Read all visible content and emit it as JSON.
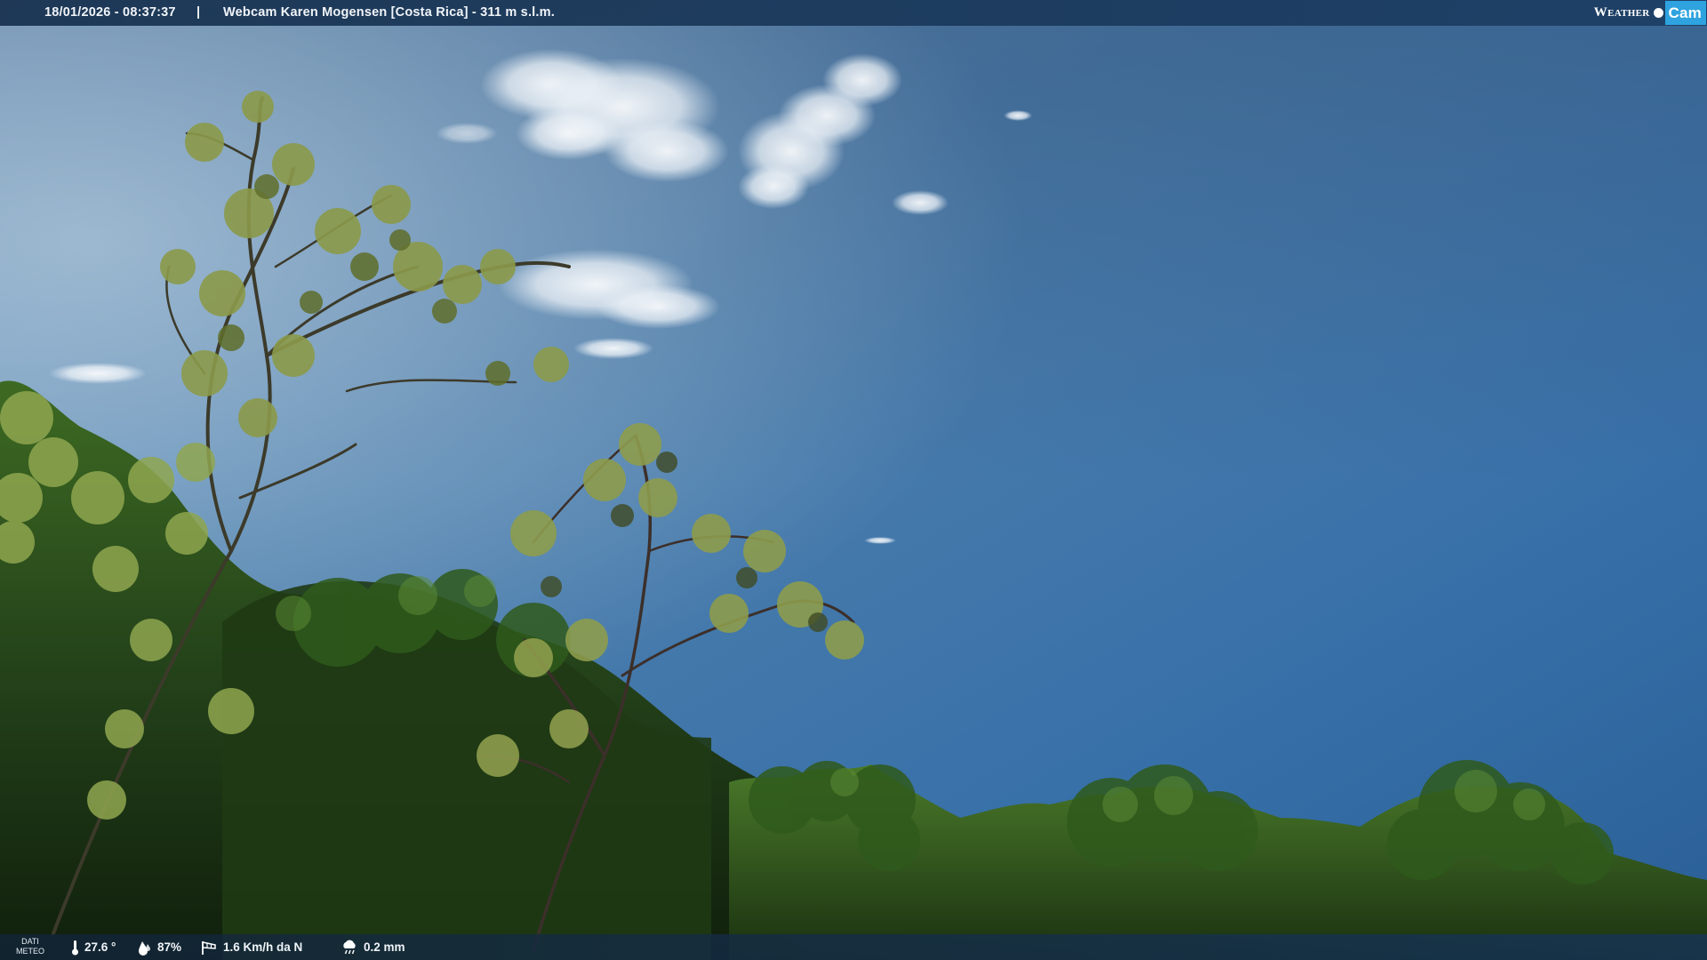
{
  "overlay": {
    "timestamp": "18/01/2026 - 08:37:37",
    "separator": "|",
    "title": "Webcam Karen Mogensen [Costa Rica] - 311 m s.l.m."
  },
  "logo": {
    "weather": "Weather",
    "cam": "Cam"
  },
  "weather_data": {
    "label_line1": "DATI",
    "label_line2": "METEO",
    "temperature": "27.6 °",
    "humidity": "87%",
    "wind": "1.6 Km/h da N",
    "rain": "0.2 mm"
  },
  "icons": {
    "temperature": "thermometer-icon",
    "humidity": "water-drop-icon",
    "wind": "windsock-icon",
    "rain": "rain-cloud-icon"
  },
  "colors": {
    "sky_top": "#5b86ad",
    "sky_bottom": "#2f6aa6",
    "foliage": "#1f3a14",
    "logo_cam": "#2ea3e0"
  }
}
